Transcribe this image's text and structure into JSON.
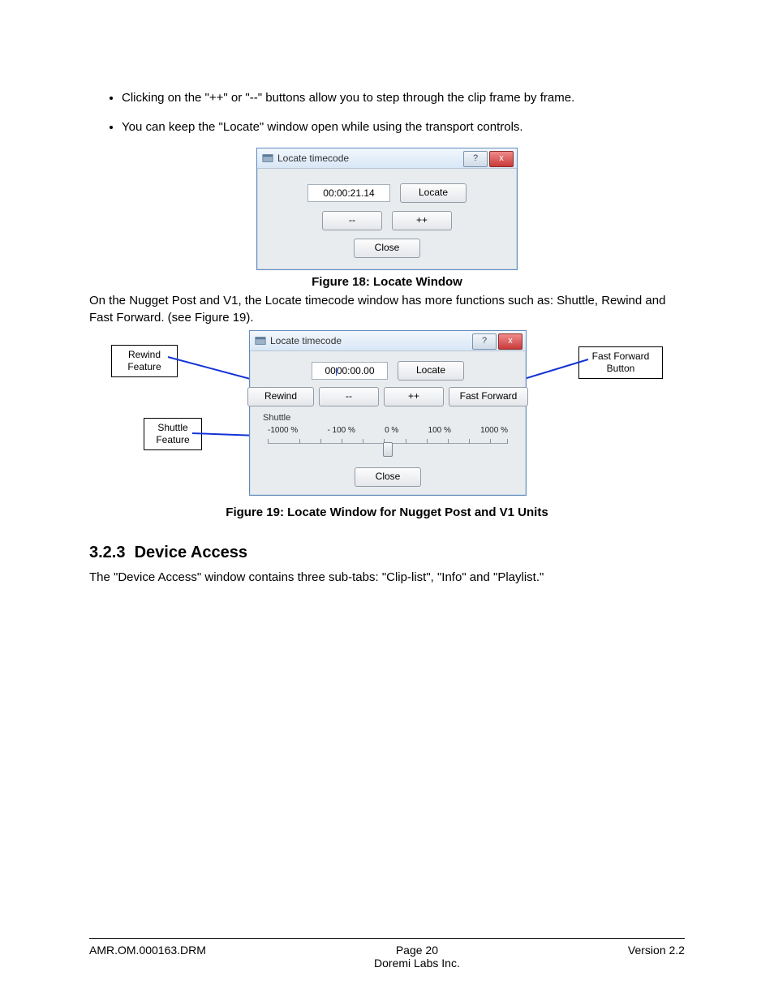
{
  "bullets": [
    "Clicking on the \"++\" or \"--\" buttons allow you to step through the clip frame by frame.",
    "You can keep the \"Locate\" window open while using the transport controls."
  ],
  "fig18": {
    "title": "Locate timecode",
    "timecode": "00:00:21.14",
    "locate": "Locate",
    "dec": "--",
    "inc": "++",
    "close": "Close",
    "caption": "Figure 18: Locate Window"
  },
  "para_after18": "On the Nugget Post and V1, the Locate timecode window has more functions such as: Shuttle, Rewind and Fast Forward. (see      Figure 19).",
  "fig19": {
    "title": "Locate timecode",
    "timecode_left": "00",
    "timecode_right": "00:00.00",
    "locate": "Locate",
    "rewind": "Rewind",
    "dec": "--",
    "inc": "++",
    "ff": "Fast Forward",
    "shuttle_label": "Shuttle",
    "ticks": [
      "-1000 %",
      "- 100 %",
      "0 %",
      "100 %",
      "1000 %"
    ],
    "close": "Close",
    "caption": "Figure 19: Locate Window for Nugget Post and V1 Units",
    "callouts": {
      "rewind": "Rewind\nFeature",
      "shuttle": "Shuttle\nFeature",
      "ff": "Fast Forward\nButton"
    }
  },
  "section": {
    "number": "3.2.3",
    "title": "Device Access",
    "body": "The \"Device Access\" window contains three sub-tabs: \"Clip-list\", \"Info\" and \"Playlist.\""
  },
  "footer": {
    "left": "AMR.OM.000163.DRM",
    "page": "Page 20",
    "company": "Doremi Labs Inc.",
    "right": "Version 2.2"
  }
}
